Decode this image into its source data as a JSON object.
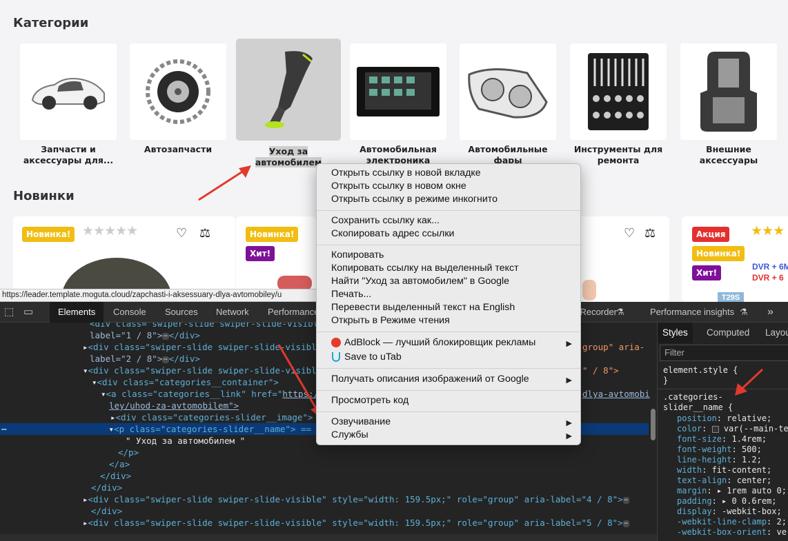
{
  "shop": {
    "categories_title": "Категории",
    "new_title": "Новинки",
    "categories": [
      {
        "name": "Запчасти и аксессуары для..."
      },
      {
        "name": "Автозапчасти"
      },
      {
        "name": "Уход за автомобилем"
      },
      {
        "name": "Автомобильная электроника"
      },
      {
        "name": "Автомобильные фары"
      },
      {
        "name": "Инструменты для ремонта"
      },
      {
        "name": "Внешние аксессуары"
      }
    ],
    "badges": {
      "new": "Новинка!",
      "hit": "Хит!",
      "sale": "Акция"
    },
    "promo": {
      "line1": "DVR + 6M",
      "line2": "DVR + 6"
    },
    "tag": "T29S"
  },
  "status_url": "https://leader.template.moguta.cloud/zapchasti-i-aksessuary-dlya-avtomobiley/u",
  "devtools": {
    "tabs": [
      "Elements",
      "Console",
      "Sources",
      "Network",
      "Performance",
      "Recorder",
      "Performance insights"
    ],
    "more": "»",
    "styles_tabs": [
      "Styles",
      "Computed",
      "Layout"
    ],
    "filter_placeholder": "Filter",
    "dom": {
      "l0a": "<div class=\"swiper-slide swiper-slide-visible\" style=\"width: 159.5px;\" role=\"group\" aria-",
      "l0b": "label=\"1 / 8\">",
      "l1a": "<div class=\"swiper-slide swiper-slide-visible\"",
      "l1b": "group\" aria-",
      "l2": "label=\"2 / 8\">",
      "l3a": "<div class=\"swiper-slide swiper-slide-visible",
      "l3b": "\" / 8\">",
      "l4": "<div class=\"categories__container\">",
      "l5a": "<a class=\"categories__link\" href=\"",
      "l5b": "https:/",
      "l5c": "dlya-avtomobi",
      "l6": "ley/uhod-za-avtomobilem\">",
      "l7": "<div class=\"categories-slider__image\">",
      "l8": "<p class=\"categories-slider__name\"> == $0",
      "l9": "\" Уход за автомобилем \"",
      "l10": "</p>",
      "l11": "</a>",
      "l12": "</div>",
      "l13": "</div>",
      "l14": "<div class=\"swiper-slide swiper-slide-visible\" style=\"width: 159.5px;\" role=\"group\" aria-label=\"4 / 8\">",
      "l15": "</div>",
      "l16": "<div class=\"swiper-slide swiper-slide-visible\" style=\"width: 159.5px;\" role=\"group\" aria-label=\"5 / 8\">",
      "close_div": "</div>"
    },
    "styles": {
      "element_style": "element.style {",
      "close": "}",
      "selector1": ".categories-",
      "selector2": "slider__name {",
      "props": [
        {
          "n": "position",
          "v": "relative;"
        },
        {
          "n": "color",
          "v": "var(--main-te"
        },
        {
          "n": "font-size",
          "v": "1.4rem;"
        },
        {
          "n": "font-weight",
          "v": "500;"
        },
        {
          "n": "line-height",
          "v": "1.2;"
        },
        {
          "n": "width",
          "v": "fit-content;"
        },
        {
          "n": "text-align",
          "v": "center;"
        },
        {
          "n": "margin",
          "v": "▸ 1rem auto 0;"
        },
        {
          "n": "padding",
          "v": "▸ 0 0.6rem;"
        },
        {
          "n": "display",
          "v": "-webkit-box;"
        },
        {
          "n": "-webkit-line-clamp",
          "v": "2;"
        },
        {
          "n": "-webkit-box-orient",
          "v": "ve"
        }
      ]
    }
  },
  "context_menu": {
    "open_new_tab": "Открыть ссылку в новой вкладке",
    "open_new_window": "Открыть ссылку в новом окне",
    "open_incognito": "Открыть ссылку в режиме инкогнито",
    "save_link": "Сохранить ссылку как...",
    "copy_link": "Скопировать адрес ссылки",
    "copy": "Копировать",
    "copy_link_text": "Копировать ссылку на выделенный текст",
    "google_search": "Найти \"Уход за автомобилем\" в Google",
    "print": "Печать...",
    "translate": "Перевести выделенный текст на English",
    "reader": "Открыть в Режиме чтения",
    "adblock": "AdBlock — лучший блокировщик рекламы",
    "utab": "Save to uTab",
    "image_desc": "Получать описания изображений от Google",
    "inspect": "Просмотреть код",
    "speech": "Озвучивание",
    "services": "Службы"
  },
  "colors": {
    "badge_yellow": "#f1bd12",
    "badge_purple": "#7f1198",
    "badge_red": "#e52f2f",
    "arrow": "#e03a2f"
  }
}
